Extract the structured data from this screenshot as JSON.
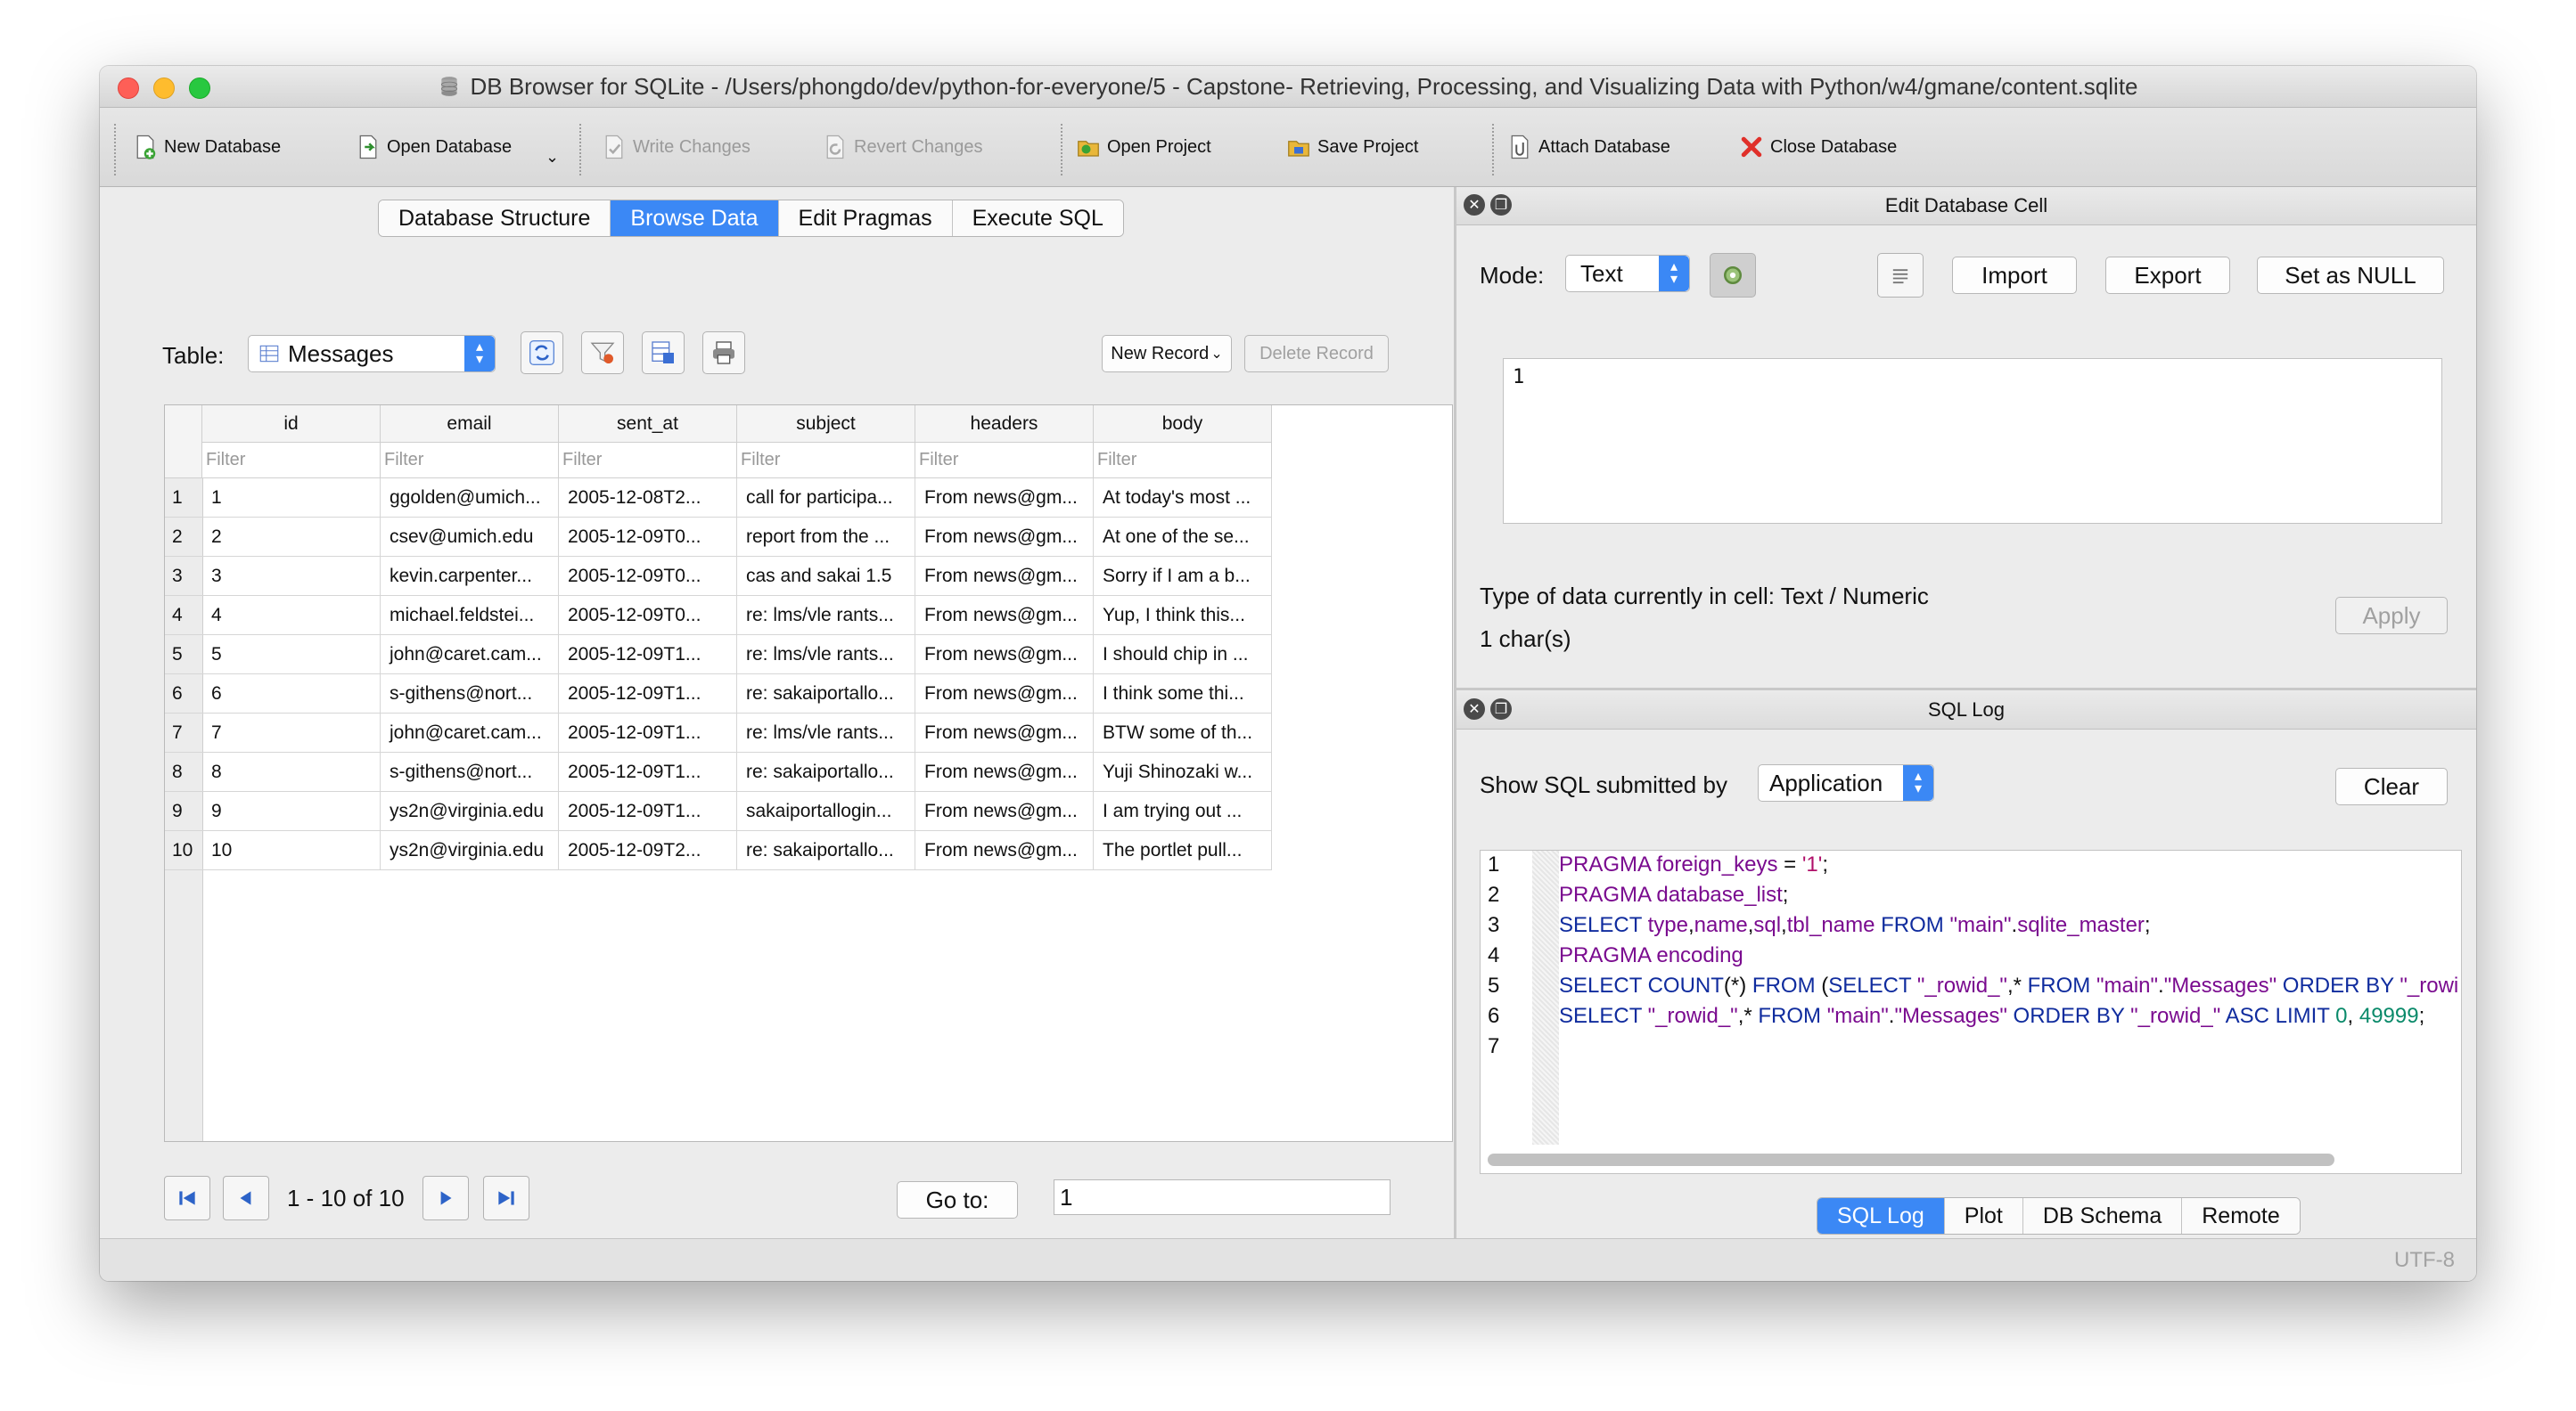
{
  "window": {
    "title": "DB Browser for SQLite - /Users/phongdo/dev/python-for-everyone/5 - Capstone- Retrieving, Processing, and Visualizing Data with Python/w4/gmane/content.sqlite"
  },
  "toolbar": {
    "new_database": "New Database",
    "open_database": "Open Database",
    "write_changes": "Write Changes",
    "revert_changes": "Revert Changes",
    "open_project": "Open Project",
    "save_project": "Save Project",
    "attach_database": "Attach Database",
    "close_database": "Close Database"
  },
  "main_tabs": [
    "Database Structure",
    "Browse Data",
    "Edit Pragmas",
    "Execute SQL"
  ],
  "browse": {
    "table_label": "Table:",
    "table_selected": "Messages",
    "new_record": "New Record",
    "delete_record": "Delete Record",
    "filter_placeholder": "Filter",
    "columns": [
      "id",
      "email",
      "sent_at",
      "subject",
      "headers",
      "body"
    ],
    "rows": [
      [
        "1",
        "1",
        "ggolden@umich...",
        "2005-12-08T2...",
        "call for participa...",
        "From news@gm...",
        "At today's most ..."
      ],
      [
        "2",
        "2",
        "csev@umich.edu",
        "2005-12-09T0...",
        "report from the ...",
        "From news@gm...",
        "At one of the se..."
      ],
      [
        "3",
        "3",
        "kevin.carpenter...",
        "2005-12-09T0...",
        "cas and sakai 1.5",
        "From news@gm...",
        "Sorry if I am a b..."
      ],
      [
        "4",
        "4",
        "michael.feldstei...",
        "2005-12-09T0...",
        "re: lms/vle rants...",
        "From news@gm...",
        "Yup, I think this..."
      ],
      [
        "5",
        "5",
        "john@caret.cam...",
        "2005-12-09T1...",
        "re: lms/vle rants...",
        "From news@gm...",
        "I should chip in ..."
      ],
      [
        "6",
        "6",
        "s-githens@nort...",
        "2005-12-09T1...",
        "re: sakaiportallo...",
        "From news@gm...",
        "I think some thi..."
      ],
      [
        "7",
        "7",
        "john@caret.cam...",
        "2005-12-09T1...",
        "re: lms/vle rants...",
        "From news@gm...",
        "BTW some of th..."
      ],
      [
        "8",
        "8",
        "s-githens@nort...",
        "2005-12-09T1...",
        "re: sakaiportallo...",
        "From news@gm...",
        "Yuji Shinozaki w..."
      ],
      [
        "9",
        "9",
        "ys2n@virginia.edu",
        "2005-12-09T1...",
        "sakaiportallogin...",
        "From news@gm...",
        "I am trying out ..."
      ],
      [
        "10",
        "10",
        "ys2n@virginia.edu",
        "2005-12-09T2...",
        "re: sakaiportallo...",
        "From news@gm...",
        "The portlet pull..."
      ]
    ],
    "pager_text": "1 - 10 of 10",
    "goto_label": "Go to:",
    "goto_value": "1"
  },
  "edit_cell": {
    "title": "Edit Database Cell",
    "mode_label": "Mode:",
    "mode_value": "Text",
    "import": "Import",
    "export": "Export",
    "set_null": "Set as NULL",
    "cell_value": "1",
    "type_info": "Type of data currently in cell: Text / Numeric",
    "size_info": "1 char(s)",
    "apply": "Apply"
  },
  "sql_log": {
    "title": "SQL Log",
    "show_label": "Show SQL submitted by",
    "submitter": "Application",
    "clear": "Clear",
    "line_numbers": [
      "1",
      "2",
      "3",
      "4",
      "5",
      "6",
      "7"
    ]
  },
  "bottom_tabs": [
    "SQL Log",
    "Plot",
    "DB Schema",
    "Remote"
  ],
  "status": {
    "encoding": "UTF-8"
  },
  "colors": {
    "accent": "#3b88f5",
    "keyword": "#7a0b8f",
    "keyword2": "#102c9e",
    "string": "#b0106a",
    "number": "#0a8a6a"
  }
}
